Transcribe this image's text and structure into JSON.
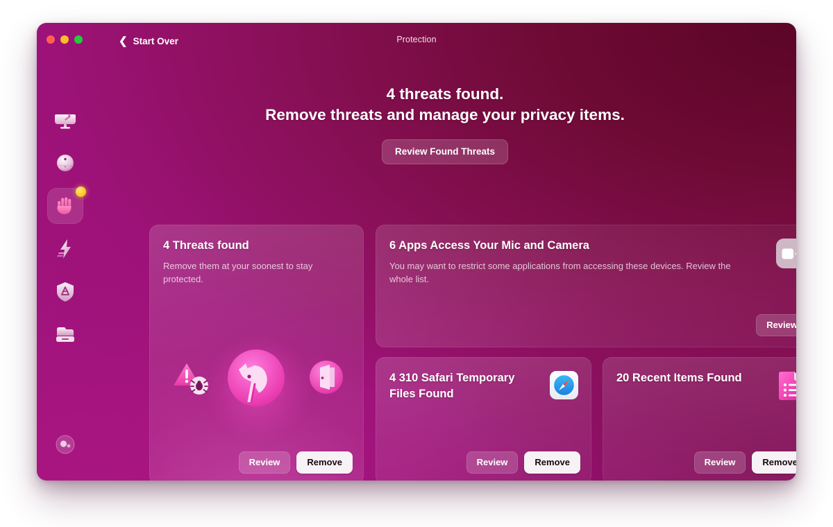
{
  "window": {
    "title": "Protection",
    "back_label": "Start Over",
    "traffic_lights": [
      "close-button",
      "minimize-button",
      "zoom-button"
    ]
  },
  "hero": {
    "line1": "4 threats found.",
    "line2": "Remove threats and manage your privacy items.",
    "cta_label": "Review Found Threats"
  },
  "sidebar": {
    "items": [
      {
        "name": "smart-scan",
        "icon": "monitor-broom-icon",
        "selected": false,
        "badge": false
      },
      {
        "name": "cleanup",
        "icon": "sphere-icon",
        "selected": false,
        "badge": false
      },
      {
        "name": "protection",
        "icon": "hand-icon",
        "selected": true,
        "badge": true
      },
      {
        "name": "performance",
        "icon": "lightning-bolt-icon",
        "selected": false,
        "badge": false
      },
      {
        "name": "applications",
        "icon": "shield-icon",
        "selected": false,
        "badge": false
      },
      {
        "name": "my-stuff",
        "icon": "drawer-icon",
        "selected": false,
        "badge": false
      }
    ],
    "account": {
      "name": "account",
      "icon": "account-orb-icon"
    }
  },
  "cards": {
    "threats": {
      "title": "4 Threats found",
      "desc": "Remove them at your soonest to stay protected.",
      "review_label": "Review",
      "remove_label": "Remove",
      "illustration": [
        "warning-bug-icon",
        "trojan-horse-icon",
        "door-icon"
      ]
    },
    "mic": {
      "title": "6 Apps Access Your Mic and Camera",
      "desc": "You may want to restrict some applications from accessing these devices. Review the whole list.",
      "review_label": "Review",
      "icon": "video-camera-icon"
    },
    "safari": {
      "title": "4 310 Safari Temporary Files Found",
      "review_label": "Review",
      "remove_label": "Remove",
      "icon": "safari-compass-icon"
    },
    "recent": {
      "title": "20 Recent Items Found",
      "review_label": "Review",
      "remove_label": "Remove",
      "icon": "document-list-icon"
    }
  },
  "colors": {
    "accent_magenta": "#a0137c",
    "deep_maroon": "#5b0527",
    "badge_yellow": "#fdd02e",
    "primary_button_bg": "#f7f2f6",
    "traffic_red": "#ff5f57",
    "traffic_yellow": "#febc2e",
    "traffic_green": "#28c840"
  }
}
